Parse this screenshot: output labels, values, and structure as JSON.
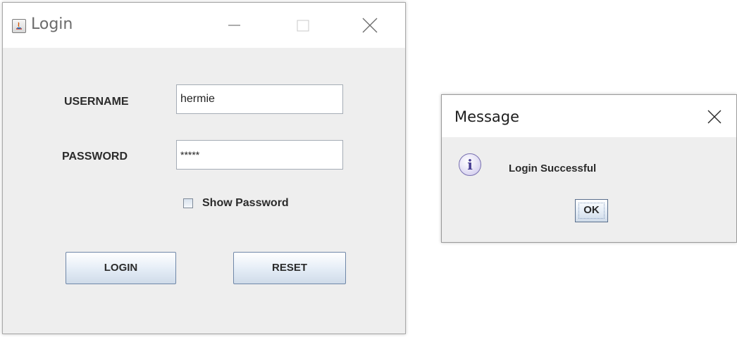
{
  "login_window": {
    "title": "Login",
    "icon": "java-app-icon",
    "controls": [
      "minimize-icon",
      "maximize-icon",
      "close-icon"
    ],
    "username": {
      "label": "USERNAME",
      "value": "hermie"
    },
    "password": {
      "label": "PASSWORD",
      "value": "*****"
    },
    "show_password": {
      "label": "Show Password",
      "checked": false
    },
    "login_button": "LOGIN",
    "reset_button": "RESET"
  },
  "message_dialog": {
    "title": "Message",
    "icon": "info-icon",
    "icon_glyph": "i",
    "text": "Login Successful",
    "ok_button": "OK"
  }
}
